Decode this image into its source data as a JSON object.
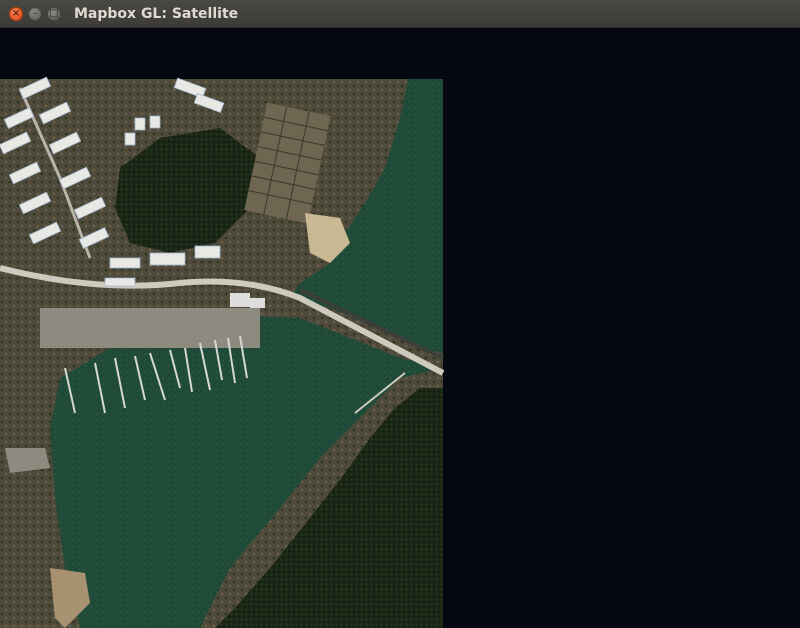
{
  "window": {
    "title": "Mapbox GL: Satellite",
    "close_glyph": "×",
    "minimize_glyph": "–",
    "maximize_glyph": "□"
  },
  "icons": {
    "close": "close-icon",
    "minimize": "minimize-icon",
    "maximize": "maximize-icon"
  },
  "colors": {
    "background": "#050810",
    "water": "#1f4a38",
    "forest": "#1c2a17",
    "land": "#5a5540",
    "urban": "#8d8a80",
    "building": "#e8e8e4",
    "road": "#cfcac0"
  },
  "map": {
    "style": "satellite"
  }
}
